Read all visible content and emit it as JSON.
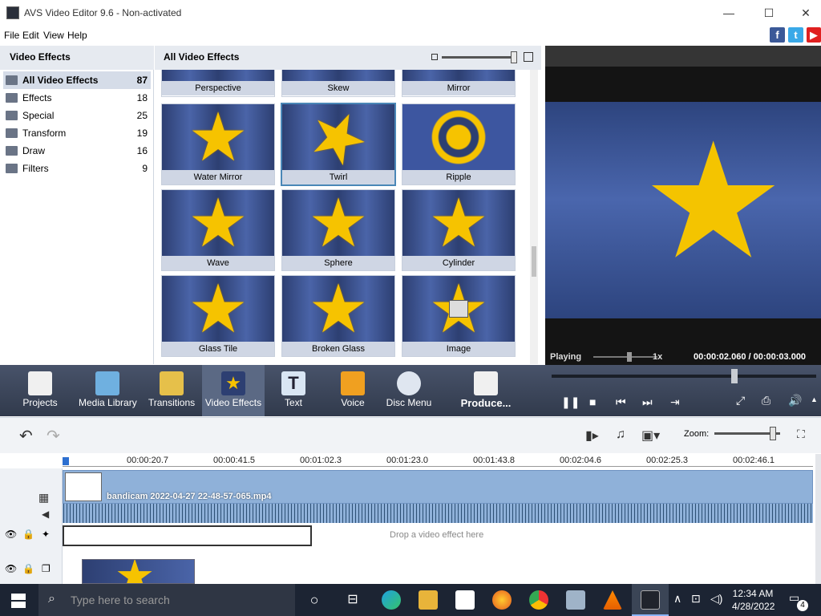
{
  "window": {
    "title": "AVS Video Editor 9.6 - Non-activated",
    "minimize": "—",
    "maximize": "☐",
    "close": "✕"
  },
  "menu": [
    "File",
    "Edit",
    "View",
    "Help"
  ],
  "social": [
    "f",
    "t",
    "▶"
  ],
  "left_panel": {
    "title": "Video Effects",
    "categories": [
      {
        "label": "All Video Effects",
        "count": "87"
      },
      {
        "label": "Effects",
        "count": "18"
      },
      {
        "label": "Special",
        "count": "25"
      },
      {
        "label": "Transform",
        "count": "19"
      },
      {
        "label": "Draw",
        "count": "16"
      },
      {
        "label": "Filters",
        "count": "9"
      }
    ]
  },
  "grid": {
    "title": "All Video Effects",
    "effects": [
      "Perspective",
      "Skew",
      "Mirror",
      "Water Mirror",
      "Twirl",
      "Ripple",
      "Wave",
      "Sphere",
      "Cylinder",
      "Glass Tile",
      "Broken Glass",
      "Image"
    ]
  },
  "preview": {
    "status": "Playing",
    "speed": "1x",
    "time": "00:00:02.060 / 00:00:03.000"
  },
  "toolbar": {
    "items": [
      "Projects",
      "Media Library",
      "Transitions",
      "Video Effects",
      "Text",
      "Voice",
      "Disc Menu",
      "Produce..."
    ],
    "icon_colors": [
      "#f0f0f0",
      "#6fb0e0",
      "#e6c04a",
      "#f6c300",
      "#d9e6f4",
      "#f0a020",
      "#dfe6f0",
      "#f0f0f0"
    ]
  },
  "timeline": {
    "zoom_label": "Zoom:",
    "ruler": [
      "00:00:20.7",
      "00:00:41.5",
      "00:01:02.3",
      "00:01:23.0",
      "00:01:43.8",
      "00:02:04.6",
      "00:02:25.3",
      "00:02:46.1"
    ],
    "clip_name": "bandicam 2022-04-27 22-48-57-065.mp4",
    "drop_hint": "Drop a video effect here"
  },
  "taskbar": {
    "search_placeholder": "Type here to search",
    "time": "12:34 AM",
    "date": "4/28/2022",
    "notifications": "4"
  }
}
